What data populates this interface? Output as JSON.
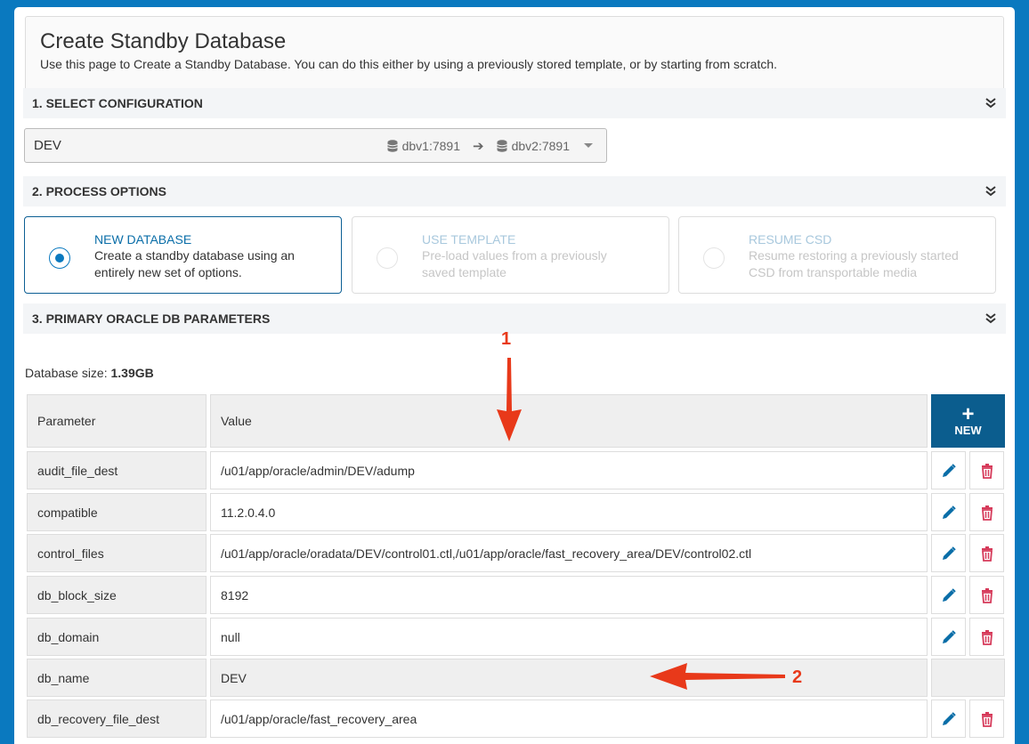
{
  "header": {
    "title": "Create Standby Database",
    "subtitle": "Use this page to Create a Standby Database. You can do this either by using a previously stored template, or by starting from scratch."
  },
  "sections": {
    "config": "1. SELECT CONFIGURATION",
    "process": "2. PROCESS OPTIONS",
    "params": "3. PRIMARY ORACLE DB PARAMETERS"
  },
  "config_select": {
    "value": "DEV",
    "source_host": "dbv1:7891",
    "target_host": "dbv2:7891"
  },
  "options": [
    {
      "title": "NEW DATABASE",
      "desc_line1": "Create a standby database using an",
      "desc_line2": "entirely new set of options.",
      "selected": true
    },
    {
      "title": "USE TEMPLATE",
      "desc_line1": "Pre-load values from a previously",
      "desc_line2": "saved template",
      "selected": false
    },
    {
      "title": "RESUME CSD",
      "desc_line1": "Resume restoring a previously started",
      "desc_line2": "CSD from transportable media",
      "selected": false
    }
  ],
  "db_size": {
    "label": "Database size:",
    "value": "1.39GB"
  },
  "table": {
    "col_parameter": "Parameter",
    "col_value": "Value",
    "new_label": "NEW",
    "rows": [
      {
        "parameter": "audit_file_dest",
        "value": "/u01/app/oracle/admin/DEV/adump"
      },
      {
        "parameter": "compatible",
        "value": "11.2.0.4.0"
      },
      {
        "parameter": "control_files",
        "value": "/u01/app/oracle/oradata/DEV/control01.ctl,/u01/app/oracle/fast_recovery_area/DEV/control02.ctl"
      },
      {
        "parameter": "db_block_size",
        "value": "8192"
      },
      {
        "parameter": "db_domain",
        "value": "null"
      },
      {
        "parameter": "db_name",
        "value": "DEV"
      },
      {
        "parameter": "db_recovery_file_dest",
        "value": "/u01/app/oracle/fast_recovery_area"
      }
    ]
  },
  "annotations": {
    "first": "1",
    "second": "2"
  },
  "colors": {
    "accent": "#0a79bf",
    "new_button": "#0b5d8e",
    "delete": "#d63a5a",
    "annotation": "#e8391a"
  }
}
